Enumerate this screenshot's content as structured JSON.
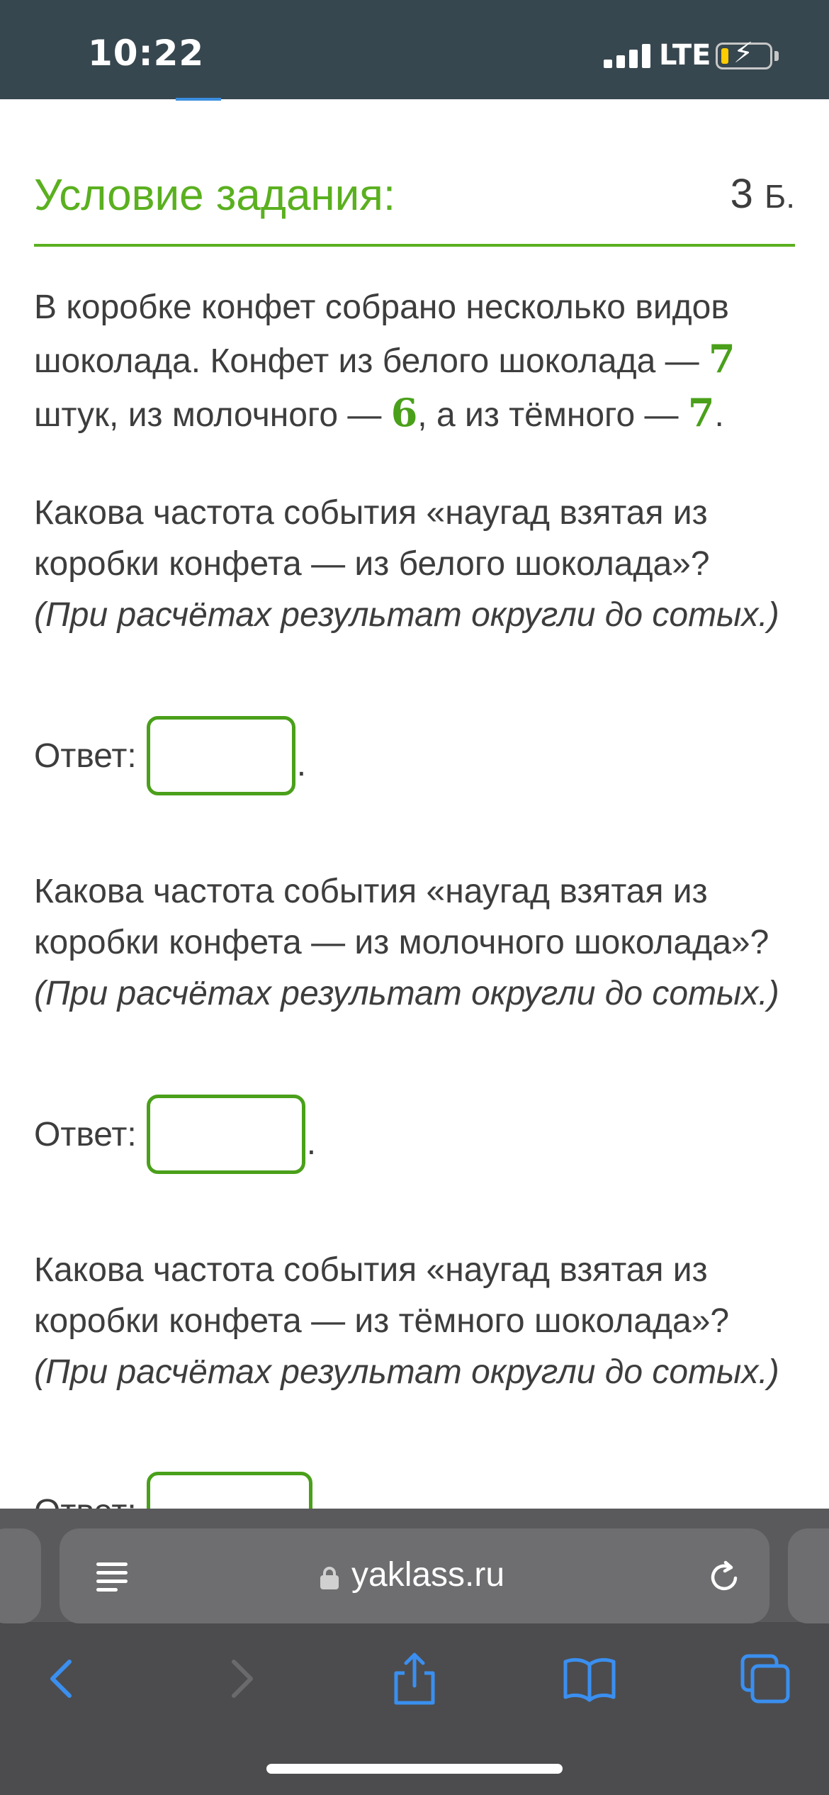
{
  "status_bar": {
    "time": "10:22",
    "network": "LTE",
    "icons": [
      "signal-icon",
      "battery-charging-icon"
    ]
  },
  "task": {
    "title": "Условие задания:",
    "points_value": "3",
    "points_unit": "Б.",
    "intro": {
      "part1": "В коробке конфет собрано несколько видов шоколада. Конфет из белого шоколада — ",
      "white_count": "7",
      "part2": " штук, из молочного — ",
      "milk_count": "6",
      "part3": ", а из тёмного — ",
      "dark_count": "7",
      "part4": "."
    },
    "questions": [
      {
        "text": "Какова частота события «наугад взятая из коробки конфета — из белого шоколада»?",
        "hint": "(При расчётах результат округли до сотых.)",
        "answer_label": "Ответ:",
        "answer_value": "",
        "answer_suffix": "."
      },
      {
        "text": "Какова частота события «наугад взятая из коробки конфета — из молочного шоколада»?",
        "hint": "(При расчётах результат округли до сотых.)",
        "answer_label": "Ответ:",
        "answer_value": "",
        "answer_suffix": "."
      },
      {
        "text": "Какова частота события «наугад взятая из коробки конфета — из тёмного шоколада»?",
        "hint": "(При расчётах результат округли до сотых.)",
        "answer_label": "Ответ:",
        "answer_value": ""
      }
    ]
  },
  "browser": {
    "url": "yaklass.ru",
    "icons": [
      "reader-icon",
      "lock-icon",
      "reload-icon",
      "back-icon",
      "forward-icon",
      "share-icon",
      "bookmarks-icon",
      "tabs-icon"
    ]
  },
  "colors": {
    "accent_green": "#5ab01f",
    "status_bar_bg": "#37474f",
    "toolbar_bg": "#4c4c4e"
  }
}
